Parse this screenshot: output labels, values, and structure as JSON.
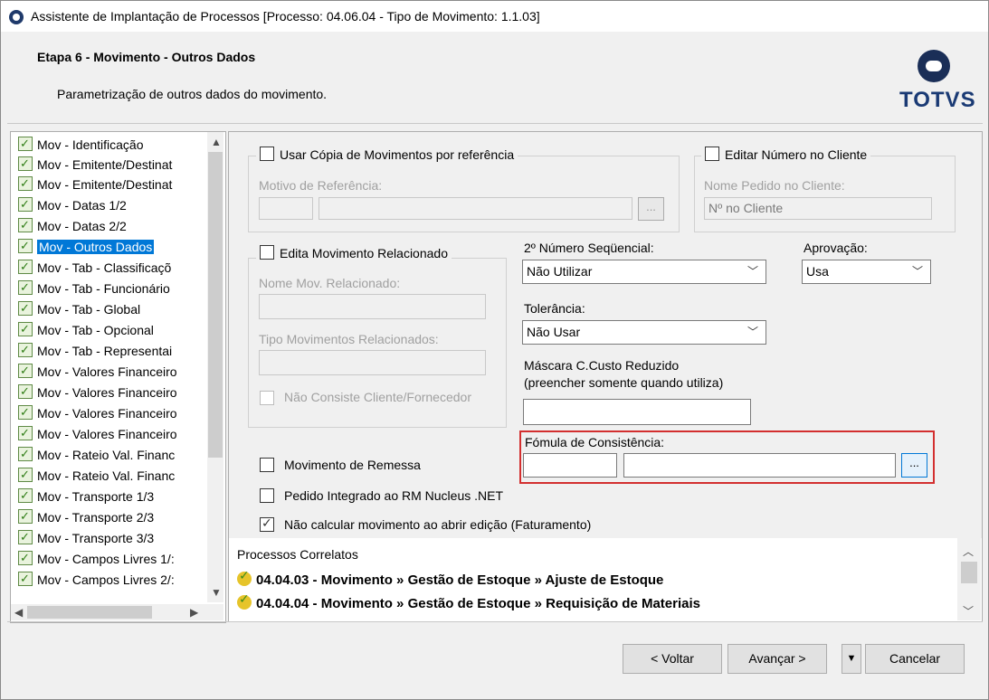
{
  "window": {
    "title": "Assistente de Implantação de Processos [Processo: 04.06.04 - Tipo de Movimento: 1.1.03]"
  },
  "header": {
    "step_title": "Etapa 6 - Movimento - Outros Dados",
    "step_description": "Parametrização de outros dados do movimento.",
    "logo_text": "TOTVS"
  },
  "steps": [
    "Mov - Identificação",
    "Mov - Emitente/Destinat",
    "Mov - Emitente/Destinat",
    "Mov - Datas 1/2",
    "Mov - Datas 2/2",
    "Mov - Outros Dados",
    "Mov - Tab - Classificaçõ",
    "Mov - Tab - Funcionário",
    "Mov - Tab - Global",
    "Mov - Tab - Opcional",
    "Mov - Tab - Representai",
    "Mov - Valores Financeiro",
    "Mov - Valores Financeiro",
    "Mov - Valores Financeiro",
    "Mov - Valores Financeiro",
    "Mov - Rateio Val. Financ",
    "Mov - Rateio Val. Financ",
    "Mov - Transporte 1/3",
    "Mov - Transporte 2/3",
    "Mov - Transporte 3/3",
    "Mov - Campos Livres 1/:",
    "Mov - Campos Livres 2/:"
  ],
  "form": {
    "copy_ref_label": "Usar Cópia de Movimentos por referência",
    "ref_motive_label": "Motivo de Referência:",
    "edit_client_number_label": "Editar Número no Cliente",
    "client_order_name_label": "Nome Pedido no Cliente:",
    "client_order_name_value": "Nº no Cliente",
    "edit_related_label": "Edita Movimento Relacionado",
    "related_name_label": "Nome Mov. Relacionado:",
    "related_types_label": "Tipo Movimentos Relacionados:",
    "not_consist_label": "Não Consiste Cliente/Fornecedor",
    "seq_label": "2º Número Seqüencial:",
    "seq_value": "Não Utilizar",
    "approval_label": "Aprovação:",
    "approval_value": "Usa",
    "tolerance_label": "Tolerância:",
    "tolerance_value": "Não Usar",
    "mask_label_1": "Máscara C.Custo Reduzido",
    "mask_label_2": "(preencher somente quando utiliza)",
    "formula_label": "Fómula de Consistência:",
    "dots": "...",
    "remessa_label": "Movimento de Remessa",
    "nucleus_label": "Pedido Integrado ao RM Nucleus .NET",
    "no_calc_label": "Não calcular movimento ao abrir edição (Faturamento)"
  },
  "correlated": {
    "title": "Processos Correlatos",
    "items": [
      "04.04.03 - Movimento » Gestão de Estoque » Ajuste de Estoque",
      "04.04.04 - Movimento » Gestão de Estoque » Requisição de Materiais"
    ]
  },
  "buttons": {
    "back": "< Voltar",
    "next": "Avançar >",
    "cancel": "Cancelar",
    "menu": "▼"
  },
  "colors": {
    "selection": "#0078d7",
    "highlight_border": "#d32f2f",
    "brand": "#1a3a74"
  }
}
